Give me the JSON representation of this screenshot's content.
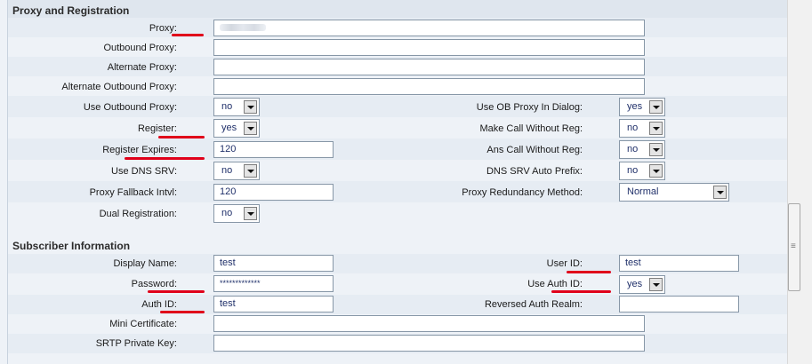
{
  "proxy_section": {
    "title": "Proxy and Registration",
    "proxy": {
      "label": "Proxy:",
      "value": ""
    },
    "outbound_proxy": {
      "label": "Outbound Proxy:",
      "value": ""
    },
    "alternate_proxy": {
      "label": "Alternate Proxy:",
      "value": ""
    },
    "alternate_outbound_proxy": {
      "label": "Alternate Outbound Proxy:",
      "value": ""
    },
    "use_outbound_proxy": {
      "label": "Use Outbound Proxy:",
      "value": "no"
    },
    "use_ob_proxy_in_dialog": {
      "label": "Use OB Proxy In Dialog:",
      "value": "yes"
    },
    "register": {
      "label": "Register:",
      "value": "yes"
    },
    "make_call_without_reg": {
      "label": "Make Call Without Reg:",
      "value": "no"
    },
    "register_expires": {
      "label": "Register Expires:",
      "value": "120"
    },
    "ans_call_without_reg": {
      "label": "Ans Call Without Reg:",
      "value": "no"
    },
    "use_dns_srv": {
      "label": "Use DNS SRV:",
      "value": "no"
    },
    "dns_srv_auto_prefix": {
      "label": "DNS SRV Auto Prefix:",
      "value": "no"
    },
    "proxy_fallback_intvl": {
      "label": "Proxy Fallback Intvl:",
      "value": "120"
    },
    "proxy_redundancy_method": {
      "label": "Proxy Redundancy Method:",
      "value": "Normal"
    },
    "dual_registration": {
      "label": "Dual Registration:",
      "value": "no"
    }
  },
  "subscriber_section": {
    "title": "Subscriber Information",
    "display_name": {
      "label": "Display Name:",
      "value": "test"
    },
    "user_id": {
      "label": "User ID:",
      "value": "test"
    },
    "password": {
      "label": "Password:",
      "value": "*************"
    },
    "use_auth_id": {
      "label": "Use Auth ID:",
      "value": "yes"
    },
    "auth_id": {
      "label": "Auth ID:",
      "value": "test"
    },
    "reversed_auth_realm": {
      "label": "Reversed Auth Realm:",
      "value": ""
    },
    "mini_certificate": {
      "label": "Mini Certificate:",
      "value": ""
    },
    "srtp_private_key": {
      "label": "SRTP Private Key:",
      "value": ""
    }
  },
  "annotation": {
    "underline_color": "#e0001a"
  },
  "colors": {
    "field_text": "#20306a",
    "band_odd": "#e6ecf3",
    "band_even": "#eef2f7"
  }
}
